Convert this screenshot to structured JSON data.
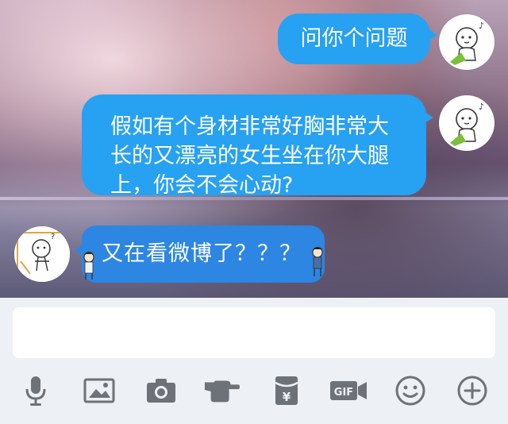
{
  "messages": [
    {
      "side": "right",
      "text": "问你个问题"
    },
    {
      "side": "right",
      "lines": [
        "假如有个身材非常好胸非常大",
        "长的又漂亮的女生坐在你大腿",
        "上，你会不会心动?"
      ]
    },
    {
      "side": "left",
      "text": "又在看微博了？？？"
    }
  ],
  "input": {
    "value": "",
    "placeholder": ""
  },
  "toolbar": {
    "items": [
      "microphone-icon",
      "image-icon",
      "camera-icon",
      "pointing-hand-icon",
      "red-packet-icon",
      "gif-icon",
      "emoji-icon",
      "add-icon"
    ],
    "gif_label": "GIF",
    "yen_label": "¥"
  },
  "colors": {
    "bubble": "#27a1f2",
    "bubble_left": "#2c86e2",
    "icon": "#6d7279",
    "panel": "#edf0f4"
  }
}
